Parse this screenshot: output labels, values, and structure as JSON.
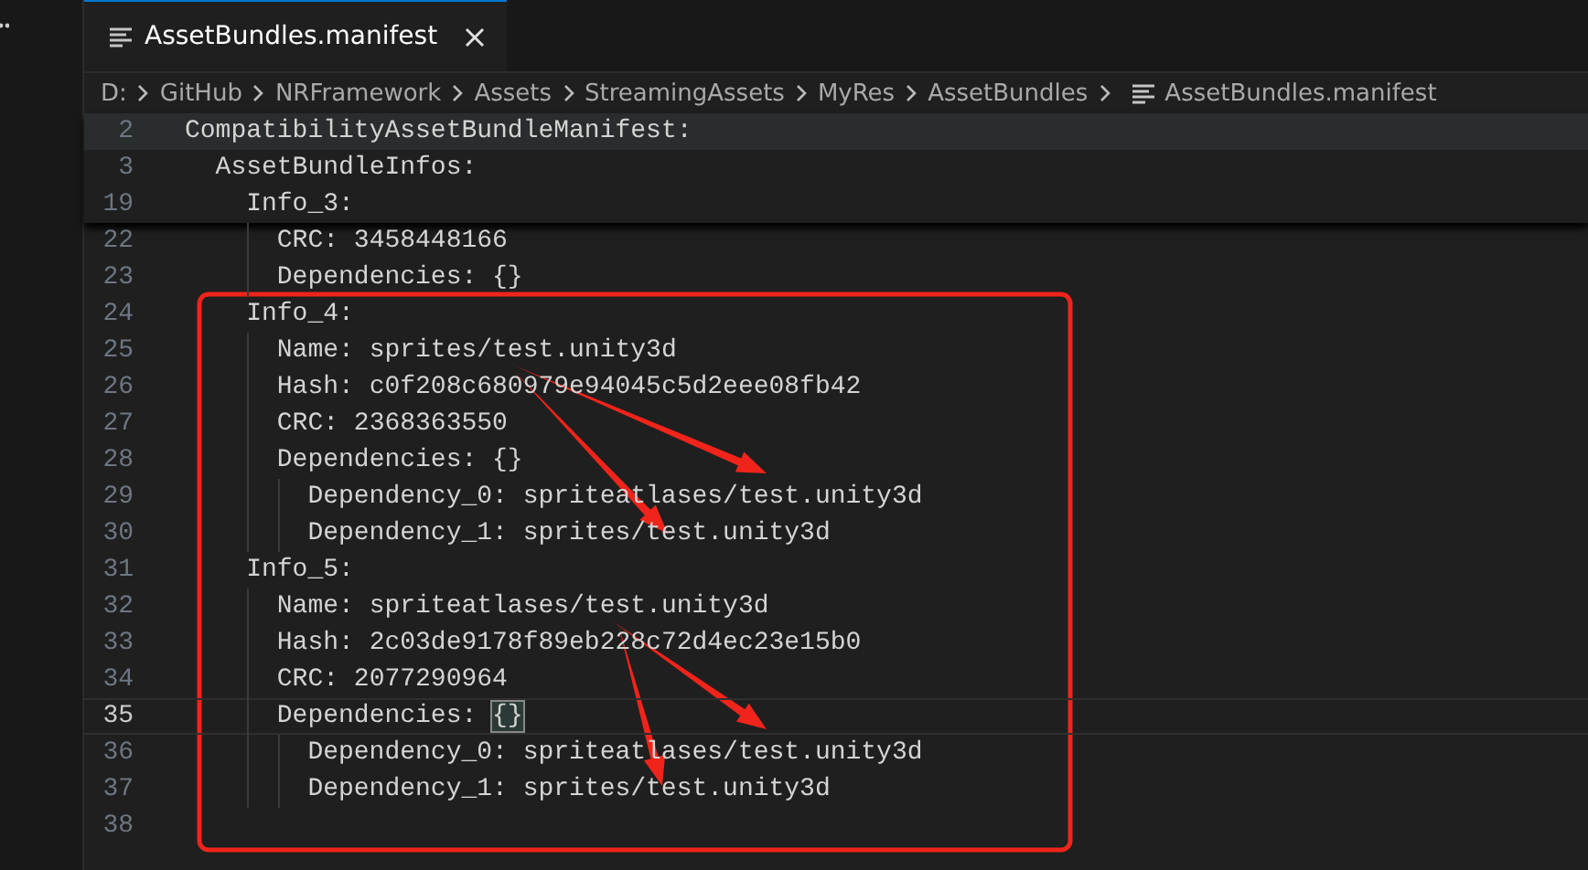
{
  "tab": {
    "label": "AssetBundles.manifest",
    "selected": true
  },
  "breadcrumb": [
    "D:",
    "GitHub",
    "NRFramework",
    "Assets",
    "StreamingAssets",
    "MyRes",
    "AssetBundles",
    "AssetBundles.manifest"
  ],
  "sticky_lines": [
    {
      "number": "2",
      "text": "CompatibilityAssetBundleManifest:",
      "current": true
    },
    {
      "number": "3",
      "text": "  AssetBundleInfos:",
      "current": false
    },
    {
      "number": "19",
      "text": "    Info_3:",
      "current": false
    }
  ],
  "lines": [
    {
      "number": "22",
      "text": "      CRC: 3458448166",
      "current": false
    },
    {
      "number": "23",
      "text": "      Dependencies: {}",
      "current": false
    },
    {
      "number": "24",
      "text": "    Info_4:",
      "current": false
    },
    {
      "number": "25",
      "text": "      Name: sprites/test.unity3d",
      "current": false
    },
    {
      "number": "26",
      "text": "      Hash: c0f208c680979e94045c5d2eee08fb42",
      "current": false
    },
    {
      "number": "27",
      "text": "      CRC: 2368363550",
      "current": false
    },
    {
      "number": "28",
      "text": "      Dependencies: {}",
      "current": false
    },
    {
      "number": "29",
      "text": "        Dependency_0: spriteatlases/test.unity3d",
      "current": false
    },
    {
      "number": "30",
      "text": "        Dependency_1: sprites/test.unity3d",
      "current": false
    },
    {
      "number": "31",
      "text": "    Info_5:",
      "current": false
    },
    {
      "number": "32",
      "text": "      Name: spriteatlases/test.unity3d",
      "current": false
    },
    {
      "number": "33",
      "text": "      Hash: 2c03de9178f89eb228c72d4ec23e15b0",
      "current": false
    },
    {
      "number": "34",
      "text": "      CRC: 2077290964",
      "current": false
    },
    {
      "number": "35",
      "text": "      Dependencies: ",
      "matched_brackets": "{}",
      "current": true
    },
    {
      "number": "36",
      "text": "        Dependency_0: spriteatlases/test.unity3d",
      "current": false
    },
    {
      "number": "37",
      "text": "        Dependency_1: sprites/test.unity3d",
      "current": false
    },
    {
      "number": "38",
      "current": false
    }
  ]
}
